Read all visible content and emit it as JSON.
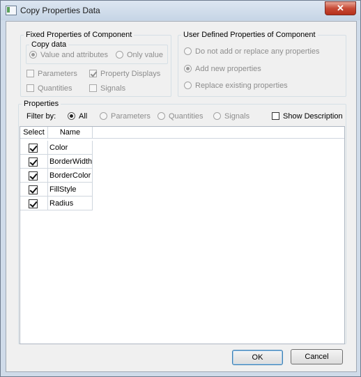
{
  "window": {
    "title": "Copy Properties Data",
    "close_glyph": "✕"
  },
  "fixed": {
    "legend": "Fixed Properties of Component",
    "copy_data": {
      "legend": "Copy data",
      "options": [
        {
          "label": "Value and attributes",
          "selected": true
        },
        {
          "label": "Only value",
          "selected": false
        }
      ]
    },
    "checks": [
      {
        "label": "Parameters",
        "checked": false
      },
      {
        "label": "Property Displays",
        "checked": true
      },
      {
        "label": "Quantities",
        "checked": false
      },
      {
        "label": "Signals",
        "checked": false
      }
    ]
  },
  "user": {
    "legend": "User Defined Properties of Component",
    "options": [
      {
        "label": "Do not add or replace any properties",
        "selected": false
      },
      {
        "label": "Add new properties",
        "selected": true
      },
      {
        "label": "Replace existing properties",
        "selected": false
      }
    ]
  },
  "properties": {
    "legend": "Properties",
    "filter_label": "Filter by:",
    "filters": [
      {
        "label": "All",
        "selected": true
      },
      {
        "label": "Parameters",
        "selected": false
      },
      {
        "label": "Quantities",
        "selected": false
      },
      {
        "label": "Signals",
        "selected": false
      }
    ],
    "show_description": {
      "label": "Show Description",
      "checked": false
    },
    "columns": [
      "Select",
      "Name"
    ],
    "rows": [
      {
        "name": "Color",
        "selected": true
      },
      {
        "name": "BorderWidth",
        "selected": true
      },
      {
        "name": "BorderColor",
        "selected": true
      },
      {
        "name": "FillStyle",
        "selected": true
      },
      {
        "name": "Radius",
        "selected": true
      }
    ]
  },
  "buttons": {
    "ok": "OK",
    "cancel": "Cancel"
  }
}
